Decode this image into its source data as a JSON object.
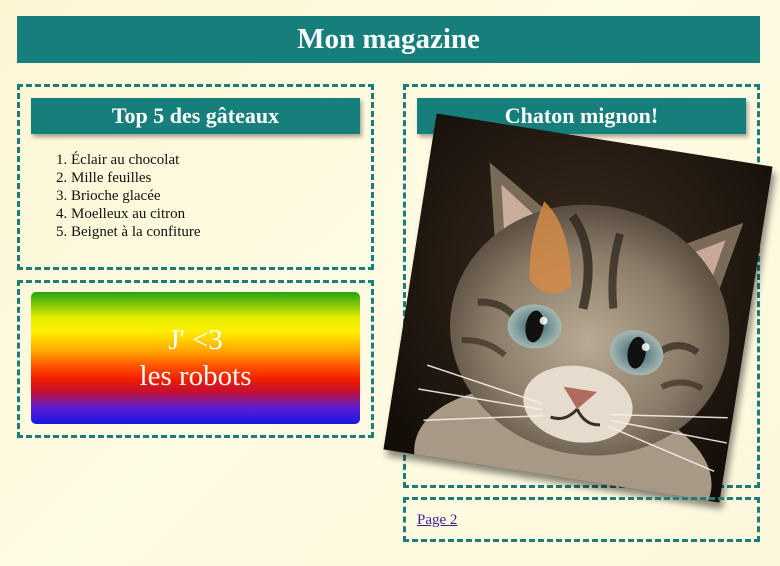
{
  "header": {
    "title": "Mon magazine"
  },
  "cakes": {
    "title": "Top 5 des gâteaux",
    "items": [
      "Éclair au chocolat",
      "Mille feuilles",
      "Brioche glacée",
      "Moelleux au citron",
      "Beignet à la confiture"
    ]
  },
  "robots": {
    "line1": "J' <3",
    "line2": "les robots"
  },
  "kitten": {
    "title": "Chaton mignon!"
  },
  "nav": {
    "page2_label": "Page 2"
  },
  "colors": {
    "accent": "#167f7c",
    "page_background": "#fdf6d3",
    "link": "#4b1a9c"
  }
}
